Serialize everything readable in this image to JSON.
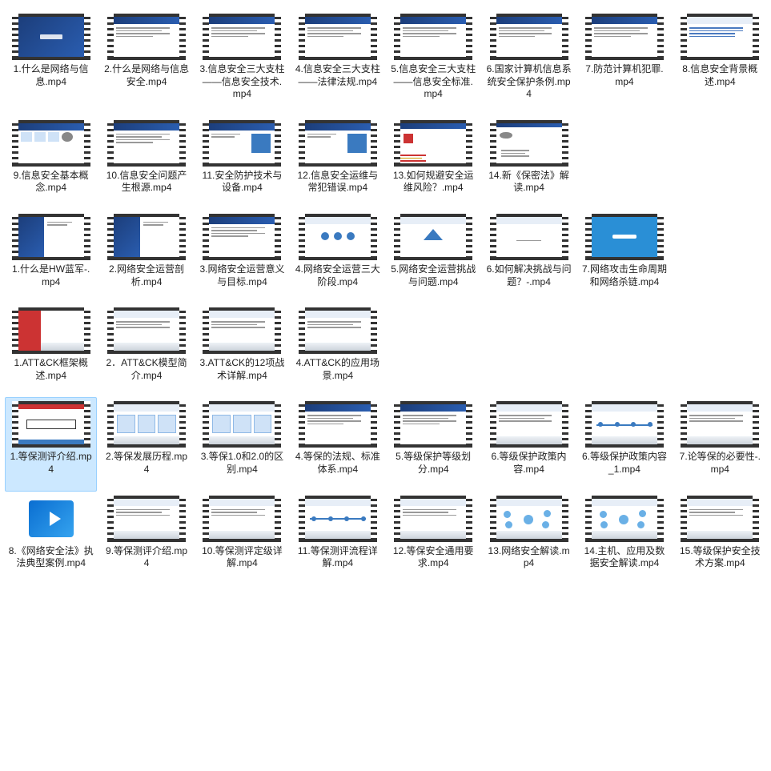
{
  "selected_index": 32,
  "items": [
    {
      "name": "1.什么是网络与信息.mp4",
      "thumb": "title"
    },
    {
      "name": "2.什么是网络与信息安全.mp4",
      "thumb": "text"
    },
    {
      "name": "3.信息安全三大支柱——信息安全技术.mp4",
      "thumb": "text"
    },
    {
      "name": "4.信息安全三大支柱——法律法规.mp4",
      "thumb": "text"
    },
    {
      "name": "5.信息安全三大支柱——信息安全标准.mp4",
      "thumb": "text"
    },
    {
      "name": "6.国家计算机信息系统安全保护条例.mp4",
      "thumb": "text"
    },
    {
      "name": "7.防范计算机犯罪.mp4",
      "thumb": "text"
    },
    {
      "name": "8.信息安全背景概述.mp4",
      "thumb": "list"
    },
    {
      "name": "9.信息安全基本概念.mp4",
      "thumb": "icons"
    },
    {
      "name": "10.信息安全问题产生根源.mp4",
      "thumb": "text"
    },
    {
      "name": "11.安全防护技术与设备.mp4",
      "thumb": "box"
    },
    {
      "name": "12.信息安全运维与常犯错误.mp4",
      "thumb": "box"
    },
    {
      "name": "13.如何规避安全运维风险？.mp4",
      "thumb": "flag"
    },
    {
      "name": "14.新《保密法》解读.mp4",
      "thumb": "gear"
    },
    {
      "name": "1.什么是HW蓝军-.mp4",
      "thumb": "bluebox"
    },
    {
      "name": "2.网络安全运营剖析.mp4",
      "thumb": "bluebox"
    },
    {
      "name": "3.网络安全运营意义与目标.mp4",
      "thumb": "text"
    },
    {
      "name": "4.网络安全运营三大阶段.mp4",
      "thumb": "dots"
    },
    {
      "name": "5.网络安全运营挑战与问题.mp4",
      "thumb": "tri"
    },
    {
      "name": "6.如何解决挑战与问题？-.mp4",
      "thumb": "plain"
    },
    {
      "name": "7.网络攻击生命周期和网络杀链.mp4",
      "thumb": "cyan"
    },
    {
      "name": "1.ATT&CK框架概述.mp4",
      "thumb": "city"
    },
    {
      "name": "2．ATT&CK模型简介.mp4",
      "thumb": "citytext"
    },
    {
      "name": "3.ATT&CK的12项战术详解.mp4",
      "thumb": "citytext"
    },
    {
      "name": "4.ATT&CK的应用场景.mp4",
      "thumb": "citytext"
    },
    {
      "name": "1.等保测评介绍.mp4",
      "thumb": "titlebox",
      "selected": true
    },
    {
      "name": "2.等保发展历程.mp4",
      "thumb": "boxes"
    },
    {
      "name": "3.等保1.0和2.0的区别.mp4",
      "thumb": "boxes"
    },
    {
      "name": "4.等保的法规、标准体系.mp4",
      "thumb": "text"
    },
    {
      "name": "5.等级保护等级划分.mp4",
      "thumb": "text"
    },
    {
      "name": "6.等级保护政策内容.mp4",
      "thumb": "citytext"
    },
    {
      "name": "6.等级保护政策内容_1.mp4",
      "thumb": "timeline"
    },
    {
      "name": "7.论等保的必要性-.mp4",
      "thumb": "citytext"
    },
    {
      "name": "8.《网络安全法》执法典型案例.mp4",
      "thumb": "videoicon"
    },
    {
      "name": "9.等保测评介绍.mp4",
      "thumb": "citytext"
    },
    {
      "name": "10.等保测评定级详解.mp4",
      "thumb": "citytext"
    },
    {
      "name": "11.等保测评流程详解.mp4",
      "thumb": "timeline"
    },
    {
      "name": "12.等保安全通用要求.mp4",
      "thumb": "citytext"
    },
    {
      "name": "13.网络安全解读.mp4",
      "thumb": "mind"
    },
    {
      "name": "14.主机、应用及数据安全解读.mp4",
      "thumb": "mind"
    },
    {
      "name": "15.等级保护安全技术方案.mp4",
      "thumb": "citytext"
    }
  ]
}
